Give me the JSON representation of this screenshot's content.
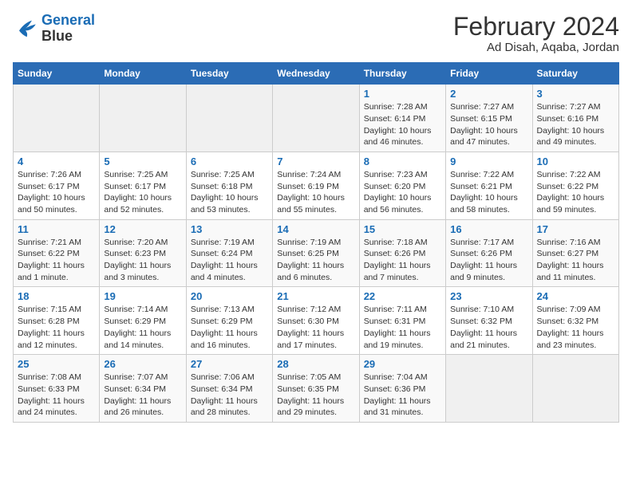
{
  "header": {
    "logo_line1": "General",
    "logo_line2": "Blue",
    "month_year": "February 2024",
    "location": "Ad Disah, Aqaba, Jordan"
  },
  "weekdays": [
    "Sunday",
    "Monday",
    "Tuesday",
    "Wednesday",
    "Thursday",
    "Friday",
    "Saturday"
  ],
  "weeks": [
    [
      {
        "day": "",
        "info": ""
      },
      {
        "day": "",
        "info": ""
      },
      {
        "day": "",
        "info": ""
      },
      {
        "day": "",
        "info": ""
      },
      {
        "day": "1",
        "info": "Sunrise: 7:28 AM\nSunset: 6:14 PM\nDaylight: 10 hours\nand 46 minutes."
      },
      {
        "day": "2",
        "info": "Sunrise: 7:27 AM\nSunset: 6:15 PM\nDaylight: 10 hours\nand 47 minutes."
      },
      {
        "day": "3",
        "info": "Sunrise: 7:27 AM\nSunset: 6:16 PM\nDaylight: 10 hours\nand 49 minutes."
      }
    ],
    [
      {
        "day": "4",
        "info": "Sunrise: 7:26 AM\nSunset: 6:17 PM\nDaylight: 10 hours\nand 50 minutes."
      },
      {
        "day": "5",
        "info": "Sunrise: 7:25 AM\nSunset: 6:17 PM\nDaylight: 10 hours\nand 52 minutes."
      },
      {
        "day": "6",
        "info": "Sunrise: 7:25 AM\nSunset: 6:18 PM\nDaylight: 10 hours\nand 53 minutes."
      },
      {
        "day": "7",
        "info": "Sunrise: 7:24 AM\nSunset: 6:19 PM\nDaylight: 10 hours\nand 55 minutes."
      },
      {
        "day": "8",
        "info": "Sunrise: 7:23 AM\nSunset: 6:20 PM\nDaylight: 10 hours\nand 56 minutes."
      },
      {
        "day": "9",
        "info": "Sunrise: 7:22 AM\nSunset: 6:21 PM\nDaylight: 10 hours\nand 58 minutes."
      },
      {
        "day": "10",
        "info": "Sunrise: 7:22 AM\nSunset: 6:22 PM\nDaylight: 10 hours\nand 59 minutes."
      }
    ],
    [
      {
        "day": "11",
        "info": "Sunrise: 7:21 AM\nSunset: 6:22 PM\nDaylight: 11 hours\nand 1 minute."
      },
      {
        "day": "12",
        "info": "Sunrise: 7:20 AM\nSunset: 6:23 PM\nDaylight: 11 hours\nand 3 minutes."
      },
      {
        "day": "13",
        "info": "Sunrise: 7:19 AM\nSunset: 6:24 PM\nDaylight: 11 hours\nand 4 minutes."
      },
      {
        "day": "14",
        "info": "Sunrise: 7:19 AM\nSunset: 6:25 PM\nDaylight: 11 hours\nand 6 minutes."
      },
      {
        "day": "15",
        "info": "Sunrise: 7:18 AM\nSunset: 6:26 PM\nDaylight: 11 hours\nand 7 minutes."
      },
      {
        "day": "16",
        "info": "Sunrise: 7:17 AM\nSunset: 6:26 PM\nDaylight: 11 hours\nand 9 minutes."
      },
      {
        "day": "17",
        "info": "Sunrise: 7:16 AM\nSunset: 6:27 PM\nDaylight: 11 hours\nand 11 minutes."
      }
    ],
    [
      {
        "day": "18",
        "info": "Sunrise: 7:15 AM\nSunset: 6:28 PM\nDaylight: 11 hours\nand 12 minutes."
      },
      {
        "day": "19",
        "info": "Sunrise: 7:14 AM\nSunset: 6:29 PM\nDaylight: 11 hours\nand 14 minutes."
      },
      {
        "day": "20",
        "info": "Sunrise: 7:13 AM\nSunset: 6:29 PM\nDaylight: 11 hours\nand 16 minutes."
      },
      {
        "day": "21",
        "info": "Sunrise: 7:12 AM\nSunset: 6:30 PM\nDaylight: 11 hours\nand 17 minutes."
      },
      {
        "day": "22",
        "info": "Sunrise: 7:11 AM\nSunset: 6:31 PM\nDaylight: 11 hours\nand 19 minutes."
      },
      {
        "day": "23",
        "info": "Sunrise: 7:10 AM\nSunset: 6:32 PM\nDaylight: 11 hours\nand 21 minutes."
      },
      {
        "day": "24",
        "info": "Sunrise: 7:09 AM\nSunset: 6:32 PM\nDaylight: 11 hours\nand 23 minutes."
      }
    ],
    [
      {
        "day": "25",
        "info": "Sunrise: 7:08 AM\nSunset: 6:33 PM\nDaylight: 11 hours\nand 24 minutes."
      },
      {
        "day": "26",
        "info": "Sunrise: 7:07 AM\nSunset: 6:34 PM\nDaylight: 11 hours\nand 26 minutes."
      },
      {
        "day": "27",
        "info": "Sunrise: 7:06 AM\nSunset: 6:34 PM\nDaylight: 11 hours\nand 28 minutes."
      },
      {
        "day": "28",
        "info": "Sunrise: 7:05 AM\nSunset: 6:35 PM\nDaylight: 11 hours\nand 29 minutes."
      },
      {
        "day": "29",
        "info": "Sunrise: 7:04 AM\nSunset: 6:36 PM\nDaylight: 11 hours\nand 31 minutes."
      },
      {
        "day": "",
        "info": ""
      },
      {
        "day": "",
        "info": ""
      }
    ]
  ]
}
